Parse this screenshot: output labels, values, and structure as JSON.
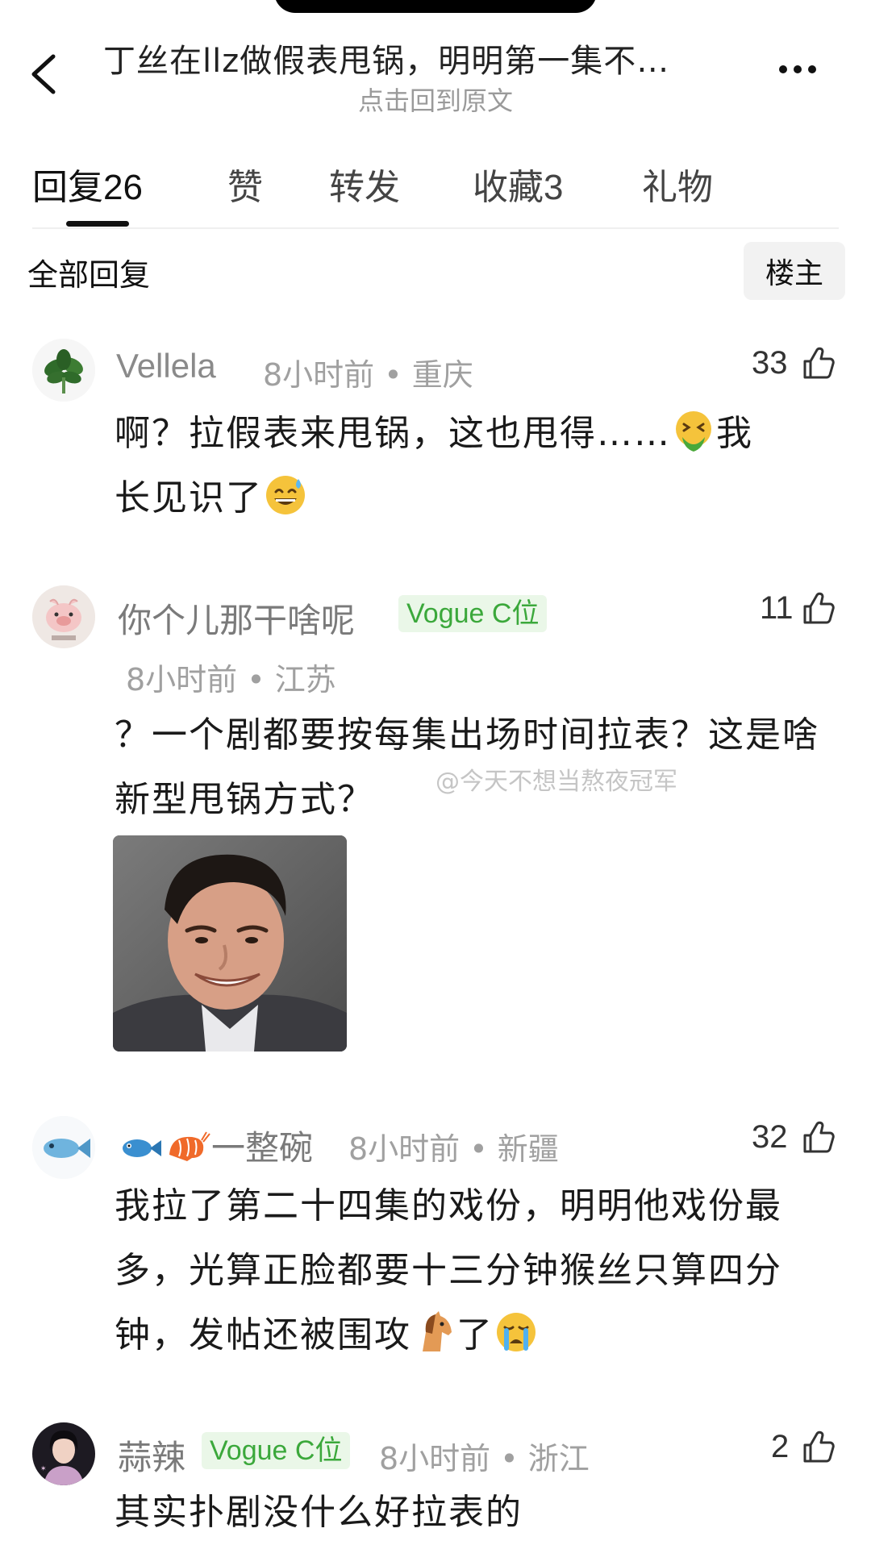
{
  "header": {
    "title": "丁丝在llz做假表甩锅，明明第一集不…",
    "subtitle": "点击回到原文"
  },
  "tabs": [
    {
      "label": "回复",
      "count": "26"
    },
    {
      "label": "赞",
      "count": ""
    },
    {
      "label": "转发",
      "count": ""
    },
    {
      "label": "收藏",
      "count": "3"
    },
    {
      "label": "礼物",
      "count": ""
    }
  ],
  "filter": {
    "all_label": "全部回复",
    "owner_label": "楼主"
  },
  "watermark": "@今天不想当熬夜冠军",
  "comments": [
    {
      "username": "Vellela",
      "time": "8小时前",
      "location": "重庆",
      "likes": "33",
      "text1": "啊？拉假表来甩锅，这也甩得……",
      "text2": "我",
      "text3": "长见识了"
    },
    {
      "username": "你个儿那干啥呢",
      "badge": "Vogue C位",
      "time": "8小时前",
      "location": "江苏",
      "likes": "11",
      "text": "？一个剧都要按每集出场时间拉表？这是啥新型甩锅方式？"
    },
    {
      "username": "一整碗",
      "time": "8小时前",
      "location": "新疆",
      "likes": "32",
      "text1": "我拉了第二十四集的戏份，明明他戏份最多，光算正脸都要十三分钟猴丝只算四分钟，发帖还被围攻",
      "text2": "了"
    },
    {
      "username": "蒜辣",
      "badge": "Vogue C位",
      "time": "8小时前",
      "location": "浙江",
      "likes": "2",
      "text": "其实扑剧没什么好拉表的"
    }
  ],
  "colors": {
    "badge_bg": "#eaf7e8",
    "badge_text": "#3ba83b",
    "meta": "#a0a0a0"
  }
}
